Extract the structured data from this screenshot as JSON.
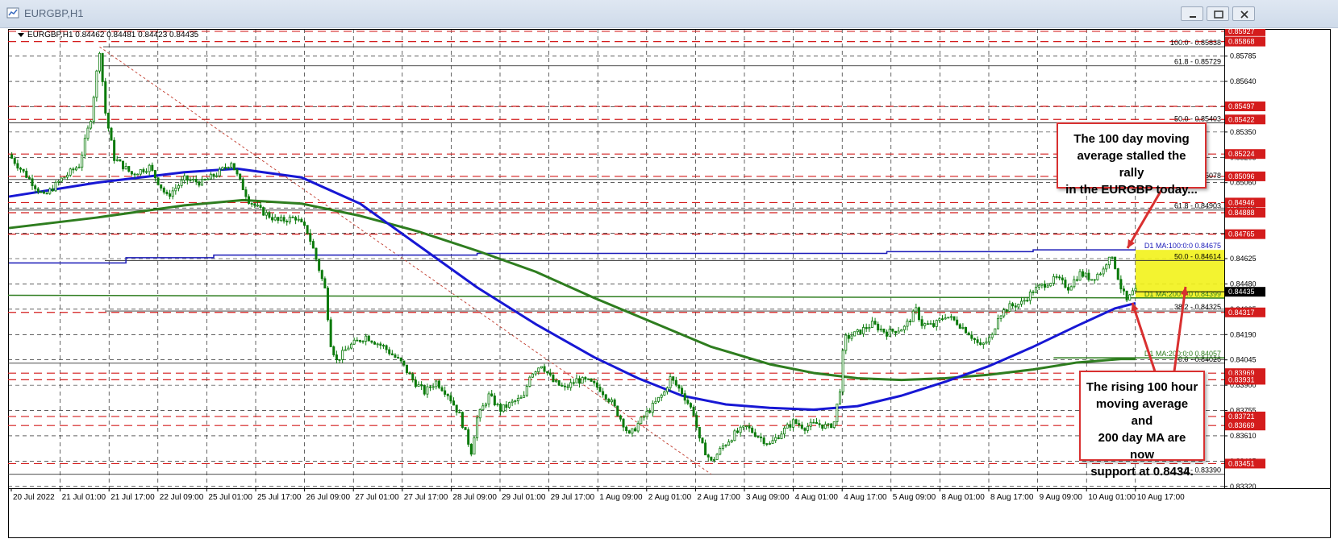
{
  "window": {
    "title": "EURGBP,H1",
    "buttons": [
      {
        "name": "minimize-button",
        "symbol": "minimize"
      },
      {
        "name": "maximize-button",
        "symbol": "maximize"
      },
      {
        "name": "close-button",
        "symbol": "close"
      }
    ]
  },
  "symbol_info": "EURGBP,H1  0.84462 0.84481 0.84423 0.84435",
  "callouts": {
    "top": "The 100 day moving\naverage stalled the rally\nin the EURGBP today...",
    "bottom": "The rising 100 hour\nmoving average and\n200 day MA are now\nsupport at 0.8434."
  },
  "colors": {
    "candle": "#0a7a0a",
    "ma100h": "#1717d4",
    "ma200h": "#2e7d1f",
    "d1_ma100": "#1a1ab8",
    "d1_ma200": "#2e7d1f",
    "red_level": "#d41c1c",
    "highlight": "#f2f21a",
    "callout_border": "#d93030",
    "current_price_bg": "#000000"
  },
  "chart_data": {
    "type": "candlestick",
    "symbol": "EURGBP",
    "timeframe": "H1",
    "ohlc_last": {
      "open": 0.84462,
      "high": 0.84481,
      "low": 0.84423,
      "close": 0.84435
    },
    "x_labels": [
      "20 Jul 2022",
      "21 Jul 01:00",
      "21 Jul 17:00",
      "22 Jul 09:00",
      "25 Jul 01:00",
      "25 Jul 17:00",
      "26 Jul 09:00",
      "27 Jul 01:00",
      "27 Jul 17:00",
      "28 Jul 09:00",
      "29 Jul 01:00",
      "29 Jul 17:00",
      "1 Aug 09:00",
      "2 Aug 01:00",
      "2 Aug 17:00",
      "3 Aug 09:00",
      "4 Aug 01:00",
      "4 Aug 17:00",
      "5 Aug 09:00",
      "8 Aug 01:00",
      "8 Aug 17:00",
      "9 Aug 09:00",
      "10 Aug 01:00",
      "10 Aug 17:00"
    ],
    "y_ticks": [
      0.85785,
      0.8564,
      0.85495,
      0.8535,
      0.85205,
      0.8506,
      0.84915,
      0.8477,
      0.84625,
      0.8448,
      0.84335,
      0.8419,
      0.84045,
      0.839,
      0.83755,
      0.8361,
      0.83465,
      0.8332
    ],
    "ylim": [
      0.8331,
      0.8594
    ],
    "current_price": 0.84435,
    "red_levels": [
      0.85927,
      0.85868,
      0.85497,
      0.85422,
      0.85224,
      0.85096,
      0.84946,
      0.84888,
      0.84765,
      0.84317,
      0.83969,
      0.83931,
      0.83721,
      0.83669,
      0.83451
    ],
    "fib_upper": [
      {
        "label": "100.0 - 0.85838",
        "price": 0.85838
      },
      {
        "label": "61.8 - 0.85729",
        "price": 0.85729
      },
      {
        "label": "50.0 - 0.85403",
        "price": 0.85403
      },
      {
        "label": "85078",
        "price": 0.85078
      },
      {
        "label": "61.8 - 0.84903",
        "price": 0.84903
      },
      {
        "label": "50.0 - 0.84614",
        "price": 0.84614
      },
      {
        "label": "38.2 - 0.84325",
        "price": 0.84325
      },
      {
        "label": "0.0 - 0.84026",
        "price": 0.84026
      },
      {
        "label": "0.0 - 0.83390",
        "price": 0.8339
      }
    ],
    "ma_lines": [
      {
        "label": "D1 MA:100:0:0 0.84675",
        "price": 0.84675
      },
      {
        "label": "D1 MA:200:0:0 0.84399",
        "price": 0.84399
      },
      {
        "label": "D1 MA:200:0:0 0.84057",
        "price": 0.84057
      }
    ],
    "highlight_zone": [
      0.84399,
      0.84675
    ],
    "ma100h": [
      [
        0,
        0.8498
      ],
      [
        30,
        0.8506
      ],
      [
        60,
        0.8512
      ],
      [
        78,
        0.8514
      ],
      [
        100,
        0.8509
      ],
      [
        120,
        0.8494
      ],
      [
        140,
        0.847
      ],
      [
        160,
        0.8446
      ],
      [
        180,
        0.8425
      ],
      [
        200,
        0.8406
      ],
      [
        215,
        0.8394
      ],
      [
        230,
        0.8384
      ],
      [
        245,
        0.8379
      ],
      [
        260,
        0.8377
      ],
      [
        275,
        0.8376
      ],
      [
        290,
        0.8378
      ],
      [
        305,
        0.8384
      ],
      [
        320,
        0.8392
      ],
      [
        335,
        0.8401
      ],
      [
        350,
        0.8412
      ],
      [
        365,
        0.8424
      ],
      [
        378,
        0.8434
      ],
      [
        385,
        0.8437
      ]
    ],
    "ma200h": [
      [
        0,
        0.848
      ],
      [
        30,
        0.8486
      ],
      [
        60,
        0.8493
      ],
      [
        80,
        0.8496
      ],
      [
        100,
        0.8494
      ],
      [
        120,
        0.8487
      ],
      [
        140,
        0.8478
      ],
      [
        160,
        0.8467
      ],
      [
        180,
        0.8455
      ],
      [
        200,
        0.844
      ],
      [
        220,
        0.8426
      ],
      [
        240,
        0.8412
      ],
      [
        260,
        0.8402
      ],
      [
        275,
        0.8397
      ],
      [
        290,
        0.8394
      ],
      [
        305,
        0.8393
      ],
      [
        320,
        0.8394
      ],
      [
        335,
        0.8396
      ],
      [
        350,
        0.8399
      ],
      [
        365,
        0.8403
      ],
      [
        380,
        0.8405
      ],
      [
        385,
        0.8405
      ]
    ],
    "price_path": [
      [
        0,
        0.8522
      ],
      [
        6,
        0.851
      ],
      [
        12,
        0.8498
      ],
      [
        18,
        0.8508
      ],
      [
        24,
        0.8516
      ],
      [
        28,
        0.8543
      ],
      [
        31,
        0.8582
      ],
      [
        33,
        0.8546
      ],
      [
        36,
        0.852
      ],
      [
        42,
        0.8511
      ],
      [
        48,
        0.8515
      ],
      [
        54,
        0.8498
      ],
      [
        60,
        0.8508
      ],
      [
        66,
        0.8506
      ],
      [
        72,
        0.8512
      ],
      [
        76,
        0.8518
      ],
      [
        78,
        0.851
      ],
      [
        82,
        0.8496
      ],
      [
        86,
        0.849
      ],
      [
        92,
        0.8484
      ],
      [
        98,
        0.8486
      ],
      [
        102,
        0.8478
      ],
      [
        104,
        0.8468
      ],
      [
        108,
        0.8445
      ],
      [
        110,
        0.8414
      ],
      [
        112,
        0.8404
      ],
      [
        116,
        0.8412
      ],
      [
        122,
        0.8418
      ],
      [
        128,
        0.8412
      ],
      [
        134,
        0.8403
      ],
      [
        138,
        0.8393
      ],
      [
        142,
        0.8386
      ],
      [
        146,
        0.8392
      ],
      [
        150,
        0.8385
      ],
      [
        154,
        0.8373
      ],
      [
        158,
        0.8352
      ],
      [
        160,
        0.8371
      ],
      [
        164,
        0.8384
      ],
      [
        168,
        0.8376
      ],
      [
        172,
        0.838
      ],
      [
        176,
        0.8383
      ],
      [
        178,
        0.8396
      ],
      [
        182,
        0.8402
      ],
      [
        186,
        0.8392
      ],
      [
        190,
        0.8388
      ],
      [
        194,
        0.8393
      ],
      [
        198,
        0.8392
      ],
      [
        202,
        0.8388
      ],
      [
        206,
        0.838
      ],
      [
        210,
        0.8368
      ],
      [
        212,
        0.8361
      ],
      [
        216,
        0.837
      ],
      [
        220,
        0.8378
      ],
      [
        224,
        0.8386
      ],
      [
        226,
        0.8394
      ],
      [
        230,
        0.8386
      ],
      [
        234,
        0.8374
      ],
      [
        236,
        0.8358
      ],
      [
        240,
        0.8346
      ],
      [
        244,
        0.8355
      ],
      [
        248,
        0.8362
      ],
      [
        252,
        0.8366
      ],
      [
        256,
        0.8361
      ],
      [
        260,
        0.8356
      ],
      [
        264,
        0.8363
      ],
      [
        268,
        0.8369
      ],
      [
        272,
        0.8366
      ],
      [
        276,
        0.8368
      ],
      [
        280,
        0.8366
      ],
      [
        282,
        0.8369
      ],
      [
        284,
        0.8388
      ],
      [
        285,
        0.8408
      ],
      [
        286,
        0.8417
      ],
      [
        290,
        0.842
      ],
      [
        295,
        0.8425
      ],
      [
        300,
        0.842
      ],
      [
        306,
        0.8423
      ],
      [
        310,
        0.8433
      ],
      [
        312,
        0.8425
      ],
      [
        316,
        0.8424
      ],
      [
        320,
        0.843
      ],
      [
        324,
        0.8426
      ],
      [
        328,
        0.842
      ],
      [
        332,
        0.8412
      ],
      [
        336,
        0.8418
      ],
      [
        338,
        0.843
      ],
      [
        342,
        0.8435
      ],
      [
        346,
        0.8437
      ],
      [
        350,
        0.8444
      ],
      [
        354,
        0.8448
      ],
      [
        358,
        0.8451
      ],
      [
        362,
        0.8446
      ],
      [
        366,
        0.8454
      ],
      [
        370,
        0.8451
      ],
      [
        374,
        0.8456
      ],
      [
        376,
        0.8465
      ],
      [
        378,
        0.8458
      ],
      [
        380,
        0.8446
      ],
      [
        382,
        0.8438
      ],
      [
        384,
        0.8443
      ],
      [
        385,
        0.84435
      ]
    ]
  }
}
